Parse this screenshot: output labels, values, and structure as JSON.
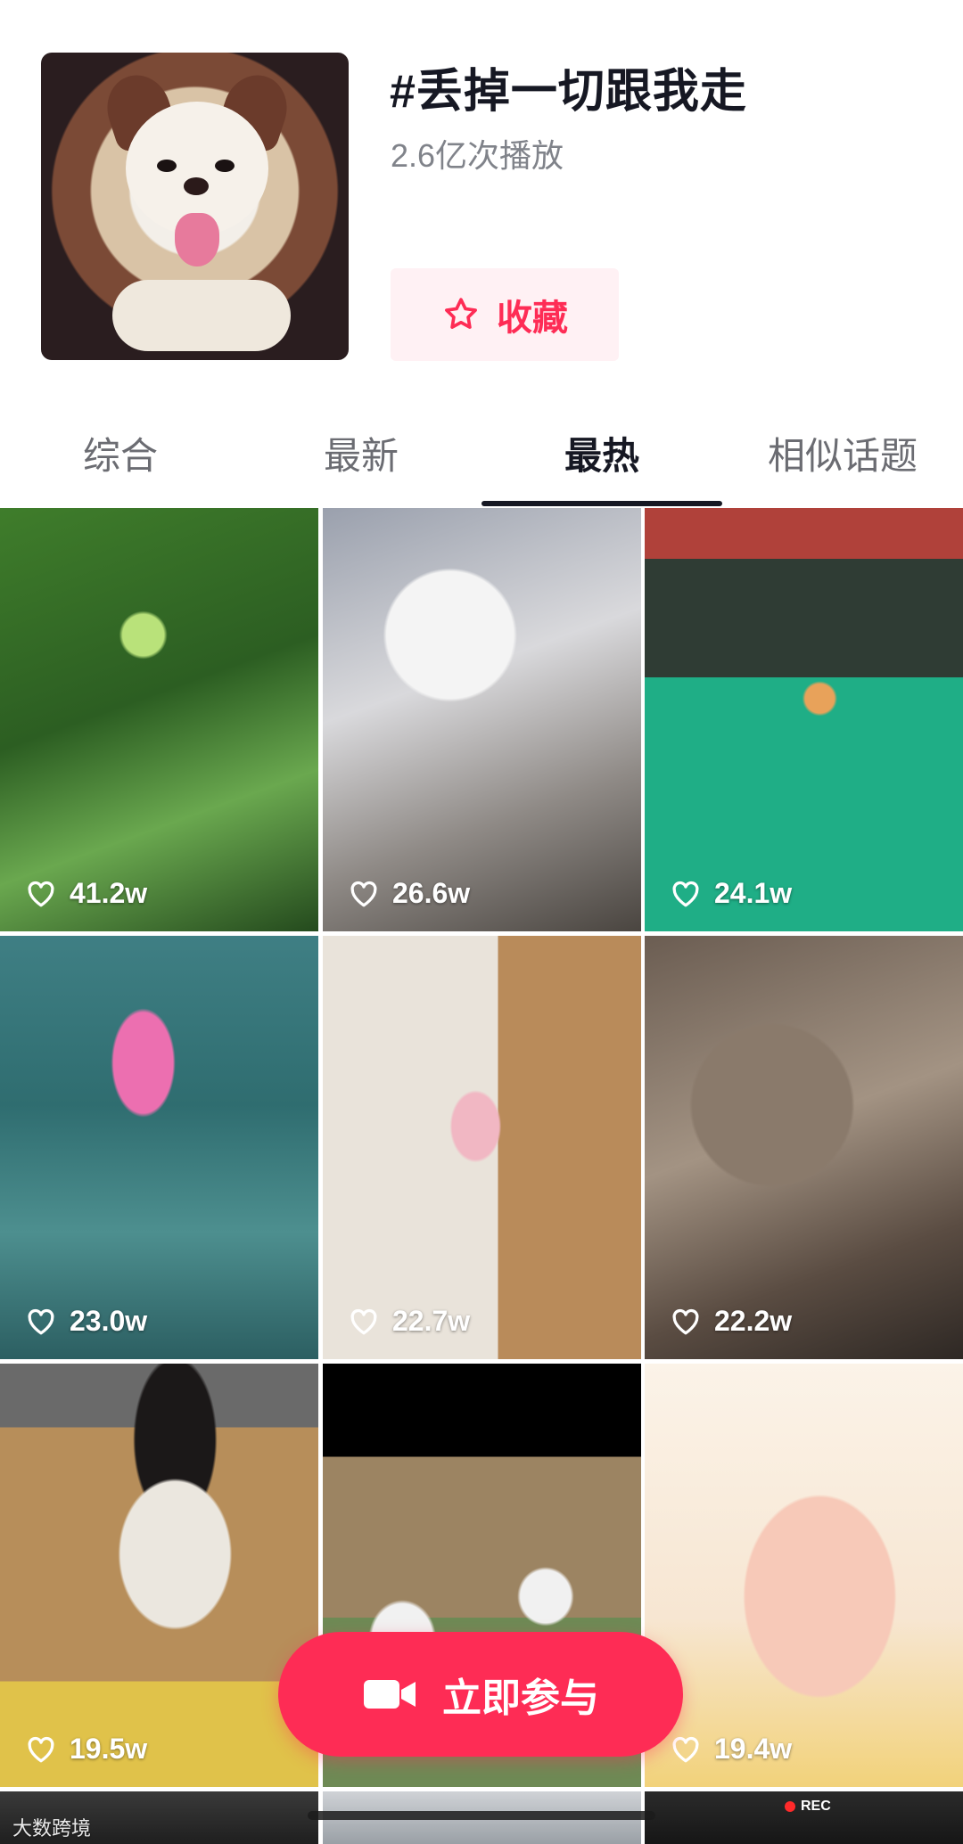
{
  "topic": {
    "title": "#丢掉一切跟我走",
    "plays": "2.6亿次播放",
    "favorite_label": "收藏"
  },
  "tabs": [
    {
      "label": "综合",
      "active": false
    },
    {
      "label": "最新",
      "active": false
    },
    {
      "label": "最热",
      "active": true
    },
    {
      "label": "相似话题",
      "active": false
    }
  ],
  "videos": [
    {
      "likes": "41.2w",
      "subject": "green-frog-on-leaves"
    },
    {
      "likes": "26.6w",
      "subject": "grey-white-cat"
    },
    {
      "likes": "24.1w",
      "subject": "orange-cat-on-roof"
    },
    {
      "likes": "23.0w",
      "subject": "pink-dolphin"
    },
    {
      "likes": "22.7w",
      "subject": "girl-in-pink-cardigan"
    },
    {
      "likes": "22.2w",
      "subject": "otter"
    },
    {
      "likes": "19.5w",
      "subject": "puppy-in-sweater"
    },
    {
      "likes": "",
      "subject": "pandas"
    },
    {
      "likes": "19.4w",
      "subject": "cartoon-sheep"
    },
    {
      "likes": "",
      "subject": "partial-row"
    },
    {
      "likes": "",
      "subject": "partial-row"
    },
    {
      "likes": "",
      "subject": "partial-row"
    }
  ],
  "cta_label": "立即参与",
  "watermark": "大数跨境",
  "rec_label": "REC",
  "colors": {
    "accent": "#fe2c55",
    "text_primary": "#161823",
    "text_secondary": "#80838a"
  },
  "icons": [
    "star-icon",
    "heart-icon",
    "video-camera-icon"
  ]
}
